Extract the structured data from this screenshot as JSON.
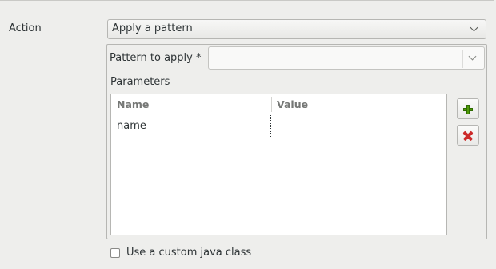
{
  "action": {
    "label": "Action",
    "selected": "Apply a pattern"
  },
  "pattern": {
    "label": "Pattern to apply *",
    "value": ""
  },
  "parameters": {
    "label": "Parameters",
    "columns": [
      "Name",
      "Value"
    ],
    "rows": [
      {
        "name": "name",
        "value": ""
      }
    ],
    "add_icon": "plus-icon",
    "remove_icon": "delete-icon"
  },
  "custom_class": {
    "label": "Use a custom java class",
    "checked": false
  },
  "colors": {
    "window_bg": "#eeeeec",
    "add_green": "#4e9a06",
    "remove_red": "#cc2a2a"
  }
}
